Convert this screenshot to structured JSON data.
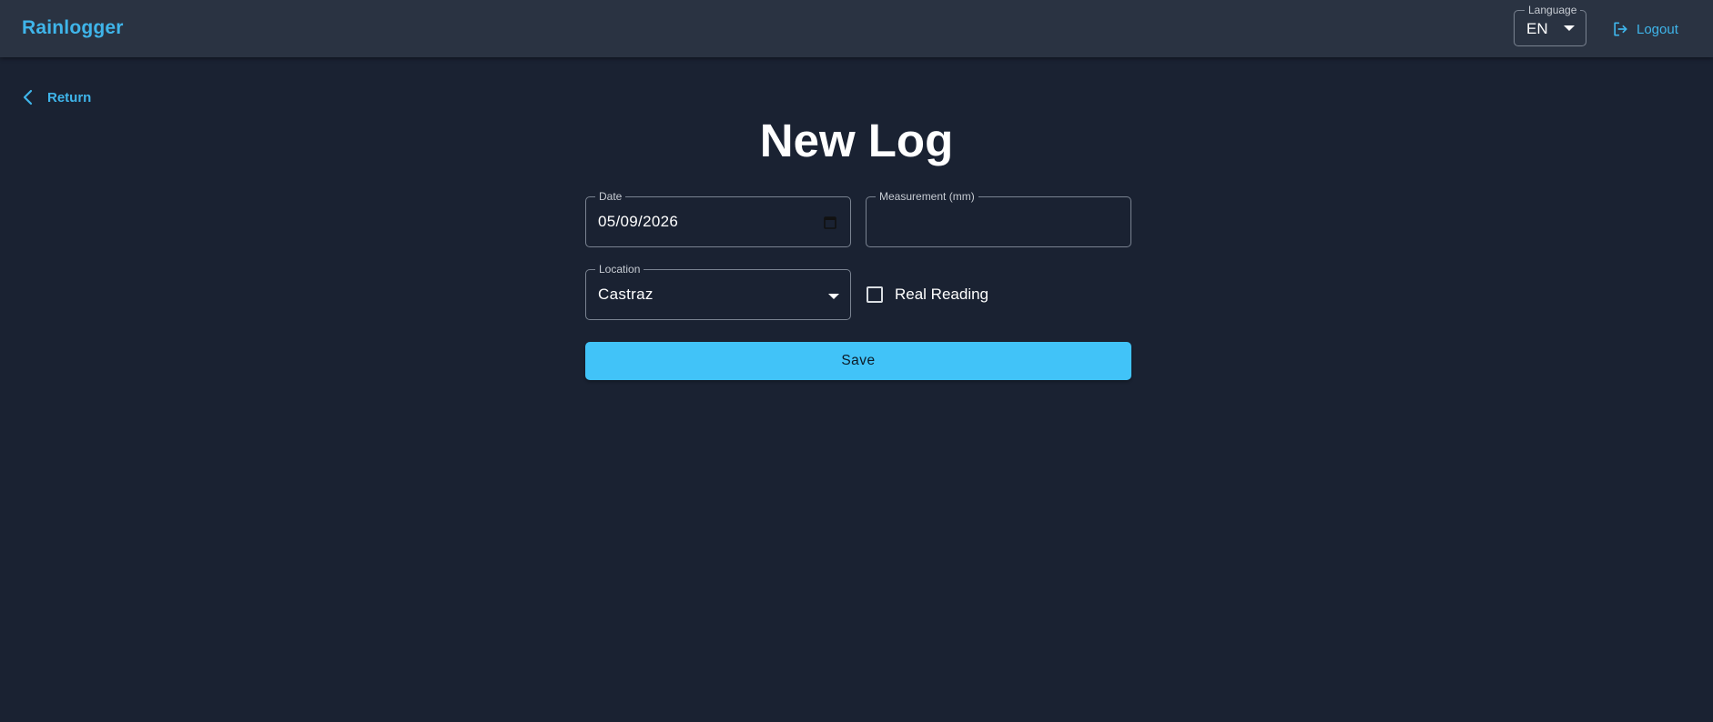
{
  "app": {
    "brand": "Rainlogger",
    "accent_color": "#3fb5ea",
    "button_color": "#41c3f8",
    "background_color": "#1a2232"
  },
  "header": {
    "language": {
      "label": "Language",
      "value": "EN",
      "icon": "caret-down-icon"
    },
    "logout": {
      "label": "Logout",
      "icon": "logout-icon"
    }
  },
  "nav": {
    "return_label": "Return",
    "return_icon": "chevron-left-icon"
  },
  "page": {
    "title": "New Log"
  },
  "form": {
    "date": {
      "label": "Date",
      "value": "05/09/2026",
      "icon": "calendar-icon"
    },
    "measurement": {
      "label": "Measurement (mm)",
      "value": ""
    },
    "location": {
      "label": "Location",
      "value": "Castraz",
      "icon": "caret-down-icon"
    },
    "real_reading": {
      "label": "Real Reading",
      "checked": false
    },
    "save_label": "Save"
  }
}
